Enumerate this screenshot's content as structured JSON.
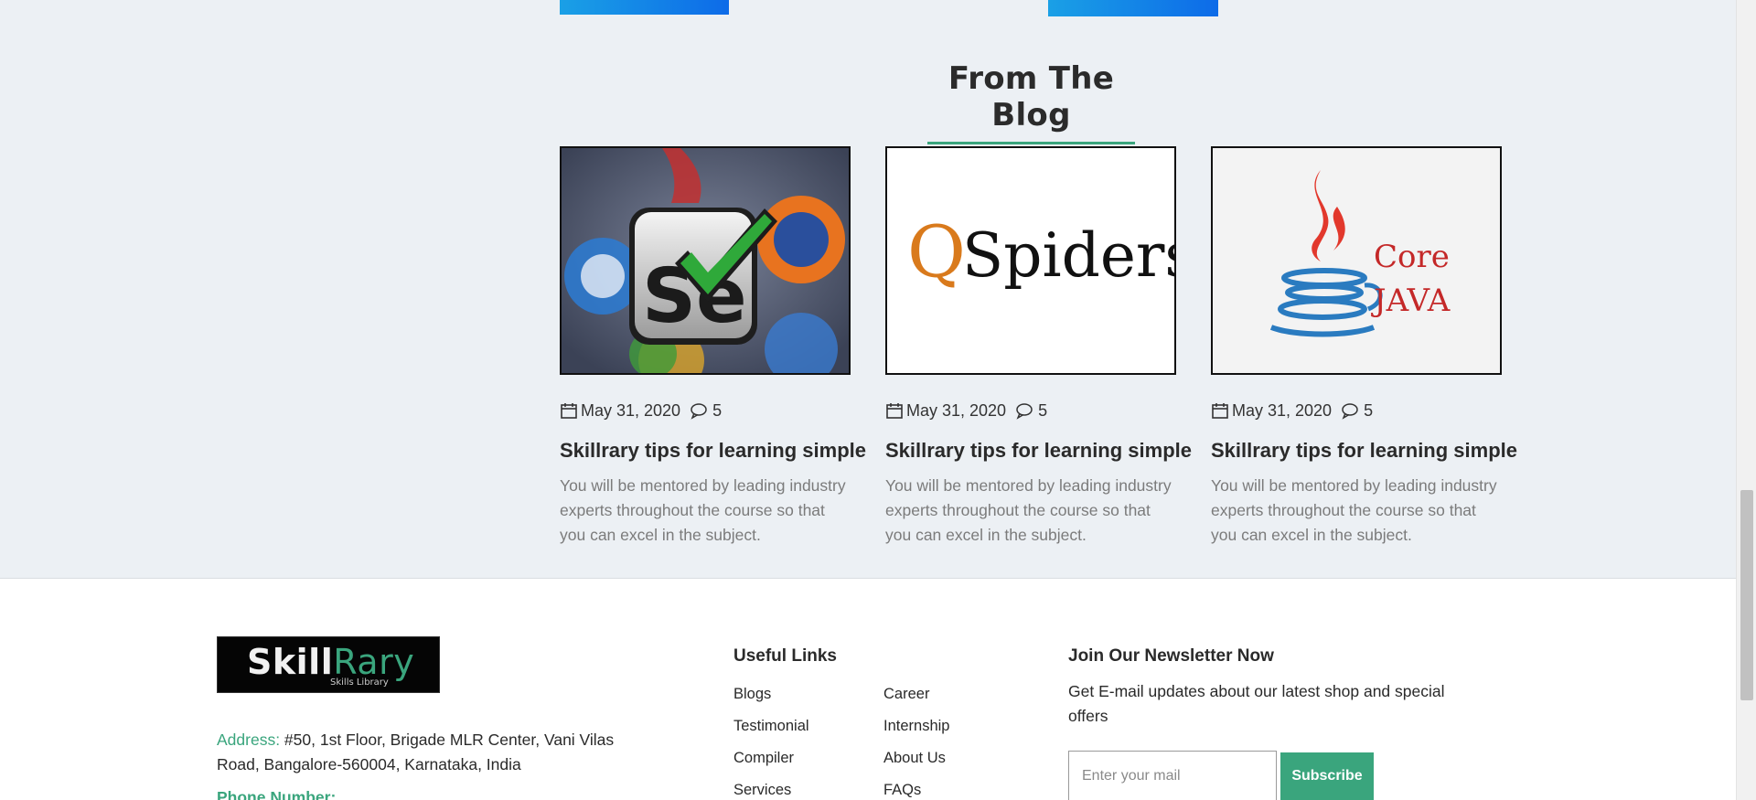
{
  "blog": {
    "heading": "From The Blog",
    "posts": [
      {
        "image_alt": "Selenium logo",
        "date": "May 31, 2020",
        "comments": "5",
        "title": "Skillrary tips for learning simple",
        "excerpt": "You will be mentored by leading industry experts throughout the course so that you can excel in the subject."
      },
      {
        "image_alt": "QSpiders logo",
        "image_text_q": "Q",
        "image_text_rest": "Spiders",
        "date": "May 31, 2020",
        "comments": "5",
        "title": "Skillrary tips for learning simple",
        "excerpt": "You will be mentored by leading industry experts throughout the course so that you can excel in the subject."
      },
      {
        "image_alt": "Core Java logo",
        "image_text_line1": "Core",
        "image_text_line2": "JAVA",
        "date": "May 31, 2020",
        "comments": "5",
        "title": "Skillrary tips for learning simple",
        "excerpt": "You will be mentored by leading industry experts throughout the course so that you can excel in the subject."
      }
    ]
  },
  "footer": {
    "logo": {
      "brand_a": "Skill",
      "brand_b": "Rary",
      "tagline": "Skills Library"
    },
    "address_label": "Address:",
    "address_text": " #50, 1st Floor, Brigade MLR Center, Vani Vilas Road, Bangalore-560004, Karnataka, India",
    "phone_label": "Phone Number:",
    "useful_links": {
      "title": "Useful Links",
      "col1": [
        "Blogs",
        "Testimonial",
        "Compiler",
        "Services"
      ],
      "col2": [
        "Career",
        "Internship",
        "About Us",
        "FAQs"
      ]
    },
    "newsletter": {
      "title": "Join Our Newsletter Now",
      "text": "Get E-mail updates about our latest shop and special offers",
      "placeholder": "Enter your mail",
      "button": "Subscribe"
    }
  },
  "colors": {
    "accent_green": "#3aa57d",
    "section_bg": "#ecf0f4",
    "banner_blue": "#1aa0e6"
  },
  "icons": {
    "date": "calendar-icon",
    "comments": "comment-icon"
  }
}
